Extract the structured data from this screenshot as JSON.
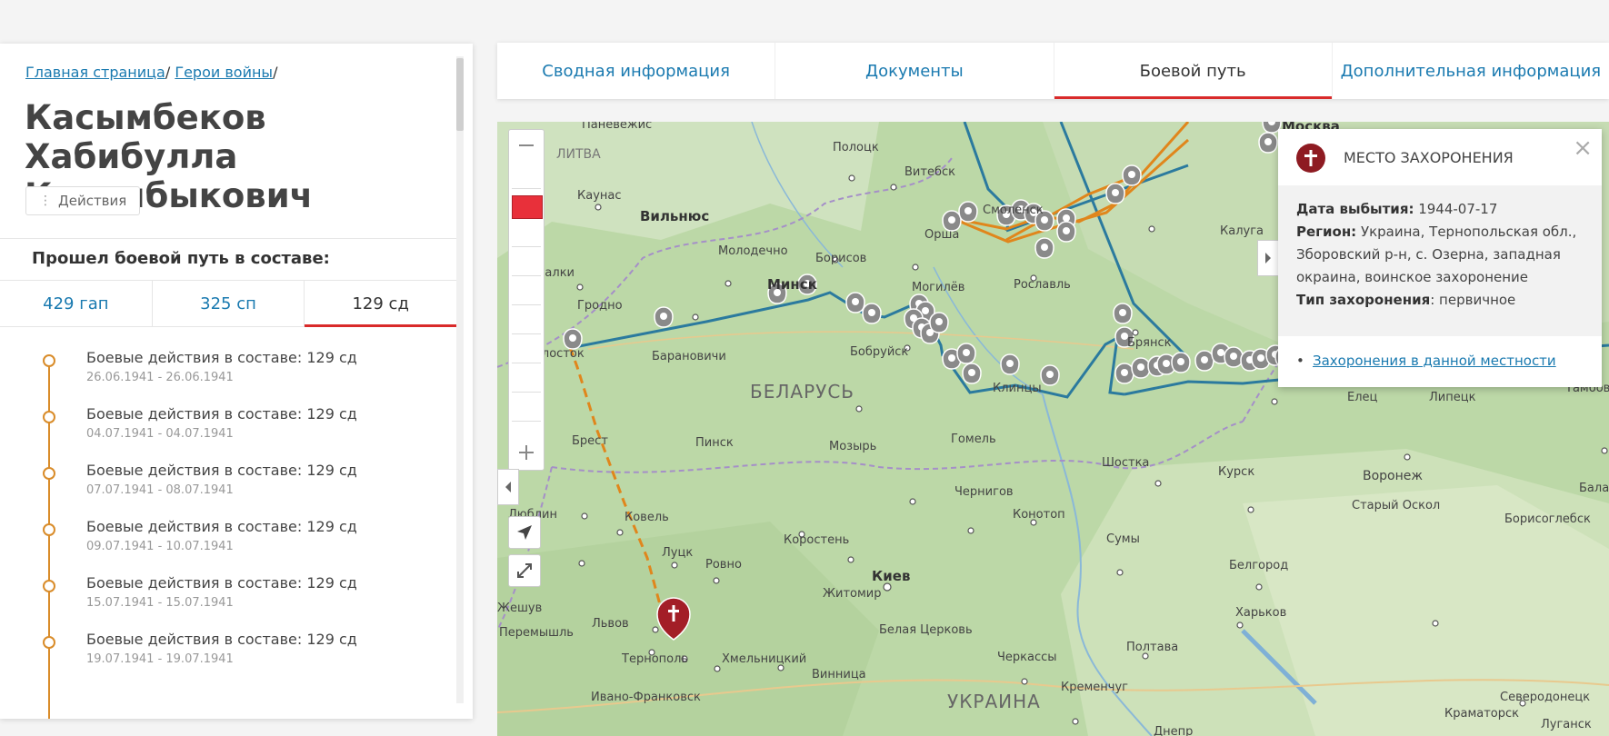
{
  "breadcrumb": {
    "home": "Главная страница",
    "sep1": "/ ",
    "heroes": "Герои войны",
    "sep2": "/"
  },
  "page_title": "Касымбеков Хабибулла Касембыкович",
  "actions": {
    "icon": "⋮",
    "label": "Действия"
  },
  "units_label": "Прошел боевой путь в составе:",
  "unit_tabs": [
    "429 гап",
    "325 сп",
    "129 сд"
  ],
  "timeline": [
    {
      "title": "Боевые действия в составе: 129 сд",
      "date": "26.06.1941 - 26.06.1941"
    },
    {
      "title": "Боевые действия в составе: 129 сд",
      "date": "04.07.1941 - 04.07.1941"
    },
    {
      "title": "Боевые действия в составе: 129 сд",
      "date": "07.07.1941 - 08.07.1941"
    },
    {
      "title": "Боевые действия в составе: 129 сд",
      "date": "09.07.1941 - 10.07.1941"
    },
    {
      "title": "Боевые действия в составе: 129 сд",
      "date": "15.07.1941 - 15.07.1941"
    },
    {
      "title": "Боевые действия в составе: 129 сд",
      "date": "19.07.1941 - 19.07.1941"
    }
  ],
  "top_tabs": [
    "Сводная информация",
    "Документы",
    "Боевой путь",
    "Дополнительная информация"
  ],
  "map": {
    "labels": {
      "panevezhis": "Паневежис",
      "litva": "ЛИТВА",
      "kaunas": "Каунас",
      "vilnius": "Вильнюс",
      "molodechno": "Молодечно",
      "minsk": "Минск",
      "borisov": "Борисов",
      "mogilev": "Могилёв",
      "orsha": "Орша",
      "vitebsk": "Витебск",
      "polotsk": "Полоцк",
      "grodno": "Гродно",
      "suvalki": "Сувалки",
      "belostok": "Белосток",
      "baranovichi": "Барановичи",
      "bobruisk": "Бобруйск",
      "belarus": "БЕЛАРУСЬ",
      "gomel": "Гомель",
      "mozyr": "Мозырь",
      "pinsk": "Пинск",
      "brest": "Брест",
      "lyublin": "Люблин",
      "kovel": "Ковель",
      "lutsk": "Луцк",
      "rovno": "Ровно",
      "zhitomir": "Житомир",
      "korosten": "Коростень",
      "kiev": "Киев",
      "chernigov": "Чернигов",
      "konotop": "Конотоп",
      "shostka": "Шостка",
      "sumy": "Сумы",
      "kursk": "Курск",
      "stary_oskol": "Старый Оскол",
      "voronezh": "Воронеж",
      "belgorod": "Белгород",
      "kharkov": "Харьков",
      "poltava": "Полтава",
      "kremenchug": "Кременчуг",
      "cherkassy": "Черкассы",
      "belaya_tserkov": "Белая Церковь",
      "vinnitsa": "Винница",
      "khmelnitsky": "Хмельницкий",
      "ternopol": "Тернополь",
      "lvov": "Львов",
      "ivano_frankovsk": "Ивано-Франковск",
      "peremyshl": "Перемышль",
      "zheshuv": "Жешув",
      "ukraina": "УКРАИНА",
      "roslavl": "Рославль",
      "bryansk": "Брянск",
      "kaluga": "Калуга",
      "moskva": "Москва",
      "smolensk": "Смоленск",
      "yelets": "Елец",
      "lipetsk": "Липецк",
      "tambov": "Тамбов",
      "novozybkov": "Клинцы",
      "balashov": "Балаш",
      "borisoglebsk": "Борисоглебск",
      "severodonetsk": "Северодонецк",
      "kramatorsk": "Краматорск",
      "lugansk": "Луганск",
      "dnepr": "Днепр"
    }
  },
  "popup": {
    "title": "МЕСТО ЗАХОРОНЕНИЯ",
    "close": "×",
    "date_label": "Дата выбытия:",
    "date_value": " 1944-07-17",
    "region_label": "Регион:",
    "region_value": " Украина, Тернопольская обл., Зборовский р-н, с. Озерна, западная окраина, воинское захоронение",
    "type_label": "Тип захоронения",
    "type_value": ": первичное",
    "bullet": "•",
    "link": "Захоронения в данной местности"
  },
  "colors": {
    "accent_red": "#d92a2a",
    "link_blue": "#1a7ab0",
    "route_blue": "#2b7a9e",
    "route_orange": "#e0861c",
    "timeline_orange": "#d98c2a",
    "marker_grey": "#8a8a8a",
    "burial_red": "#8e1b22"
  }
}
